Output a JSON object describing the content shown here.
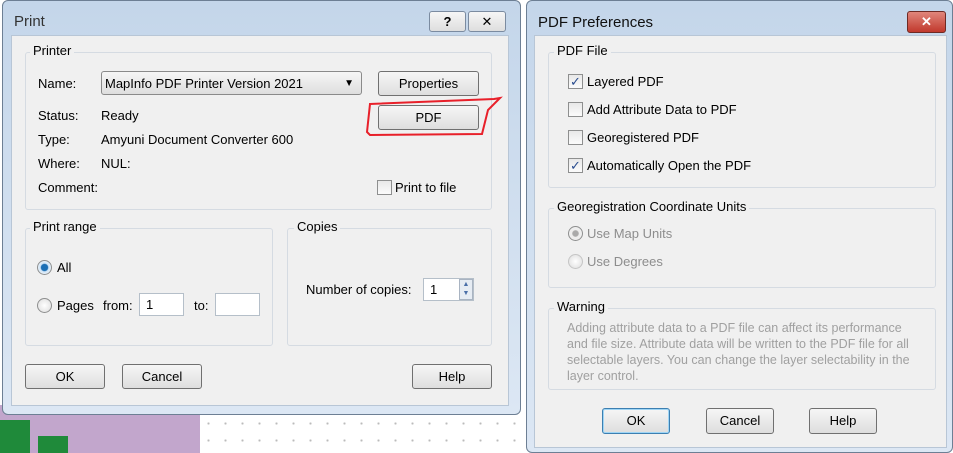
{
  "print": {
    "title": "Print",
    "help_btn": "?",
    "close_btn": "✕",
    "printer_group": "Printer",
    "name_label": "Name:",
    "name_value": "MapInfo PDF Printer Version 2021",
    "properties_btn": "Properties",
    "pdf_btn": "PDF",
    "status_label": "Status:",
    "status_value": "Ready",
    "type_label": "Type:",
    "type_value": "Amyuni Document Converter 600",
    "where_label": "Where:",
    "where_value": "NUL:",
    "comment_label": "Comment:",
    "print_to_file": "Print to file",
    "range_group": "Print range",
    "all_label": "All",
    "pages_label": "Pages",
    "from_label": "from:",
    "from_value": "1",
    "to_label": "to:",
    "to_value": "",
    "copies_group": "Copies",
    "copies_label": "Number of copies:",
    "copies_value": "1",
    "ok": "OK",
    "cancel": "Cancel",
    "help": "Help"
  },
  "prefs": {
    "title": "PDF Preferences",
    "close_btn": "✕",
    "file_group": "PDF File",
    "options": [
      {
        "label": "Layered PDF",
        "checked": "✓"
      },
      {
        "label": "Add Attribute Data to PDF",
        "checked": ""
      },
      {
        "label": "Georegistered PDF",
        "checked": ""
      },
      {
        "label": "Automatically Open the PDF",
        "checked": "✓"
      }
    ],
    "units_group": "Georegistration Coordinate Units",
    "use_map_units": "Use Map Units",
    "use_degrees": "Use Degrees",
    "warning_group": "Warning",
    "warning_lines": [
      "Adding attribute data to a PDF file can affect its performance",
      "and file size. Attribute data will be written to the PDF file for all",
      "selectable layers. You can change the layer selectability in the",
      "layer control."
    ],
    "ok": "OK",
    "cancel": "Cancel",
    "help": "Help"
  },
  "colors": {
    "annotation": "#e8202a",
    "close_red": "#c9463d"
  }
}
